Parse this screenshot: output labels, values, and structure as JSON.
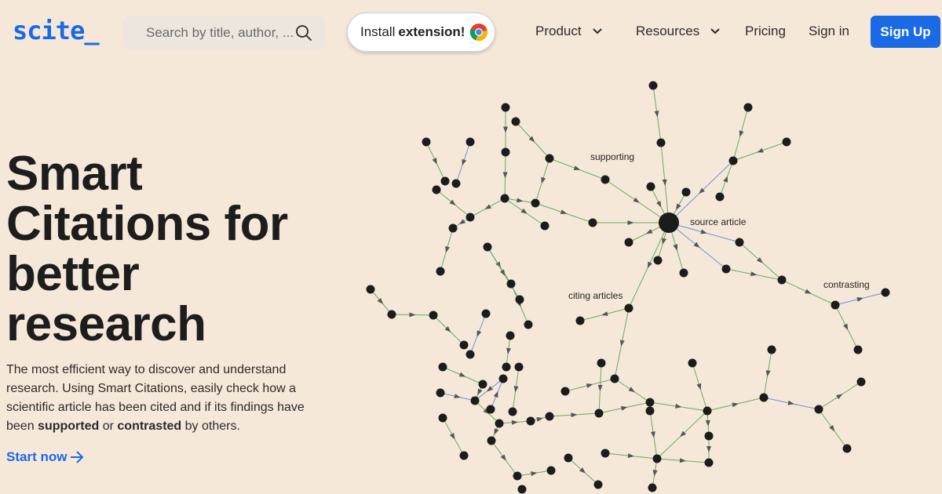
{
  "header": {
    "logo": "scite_",
    "search_placeholder": "Search by title, author, ...",
    "extension_prefix": "Install",
    "extension_bold": "extension!",
    "nav": [
      {
        "label": "Product",
        "has_dropdown": true
      },
      {
        "label": "Resources",
        "has_dropdown": true
      },
      {
        "label": "Pricing",
        "has_dropdown": false
      },
      {
        "label": "Sign in",
        "has_dropdown": false
      }
    ],
    "signup": "Sign Up"
  },
  "hero": {
    "title_lines": [
      "Smart",
      "Citations for",
      "better",
      "research"
    ],
    "desc_part1": "The most efficient way to discover and understand research. Using Smart Citations, easily check how a scientific article has been cited and if its findings have been ",
    "desc_bold1": "supported",
    "desc_part2": " or ",
    "desc_bold2": "contrasted",
    "desc_part3": " by others.",
    "cta": "Start now"
  },
  "graph": {
    "labels": {
      "supporting": "supporting",
      "source": "source article",
      "citing": "citing articles",
      "contrasting": "contrasting"
    }
  },
  "colors": {
    "accent": "#1a6ae6",
    "background": "#f6e8d9",
    "edge_support": "#5fae5f",
    "edge_contrast": "#6b8ee6",
    "node": "#1c1c1c"
  }
}
